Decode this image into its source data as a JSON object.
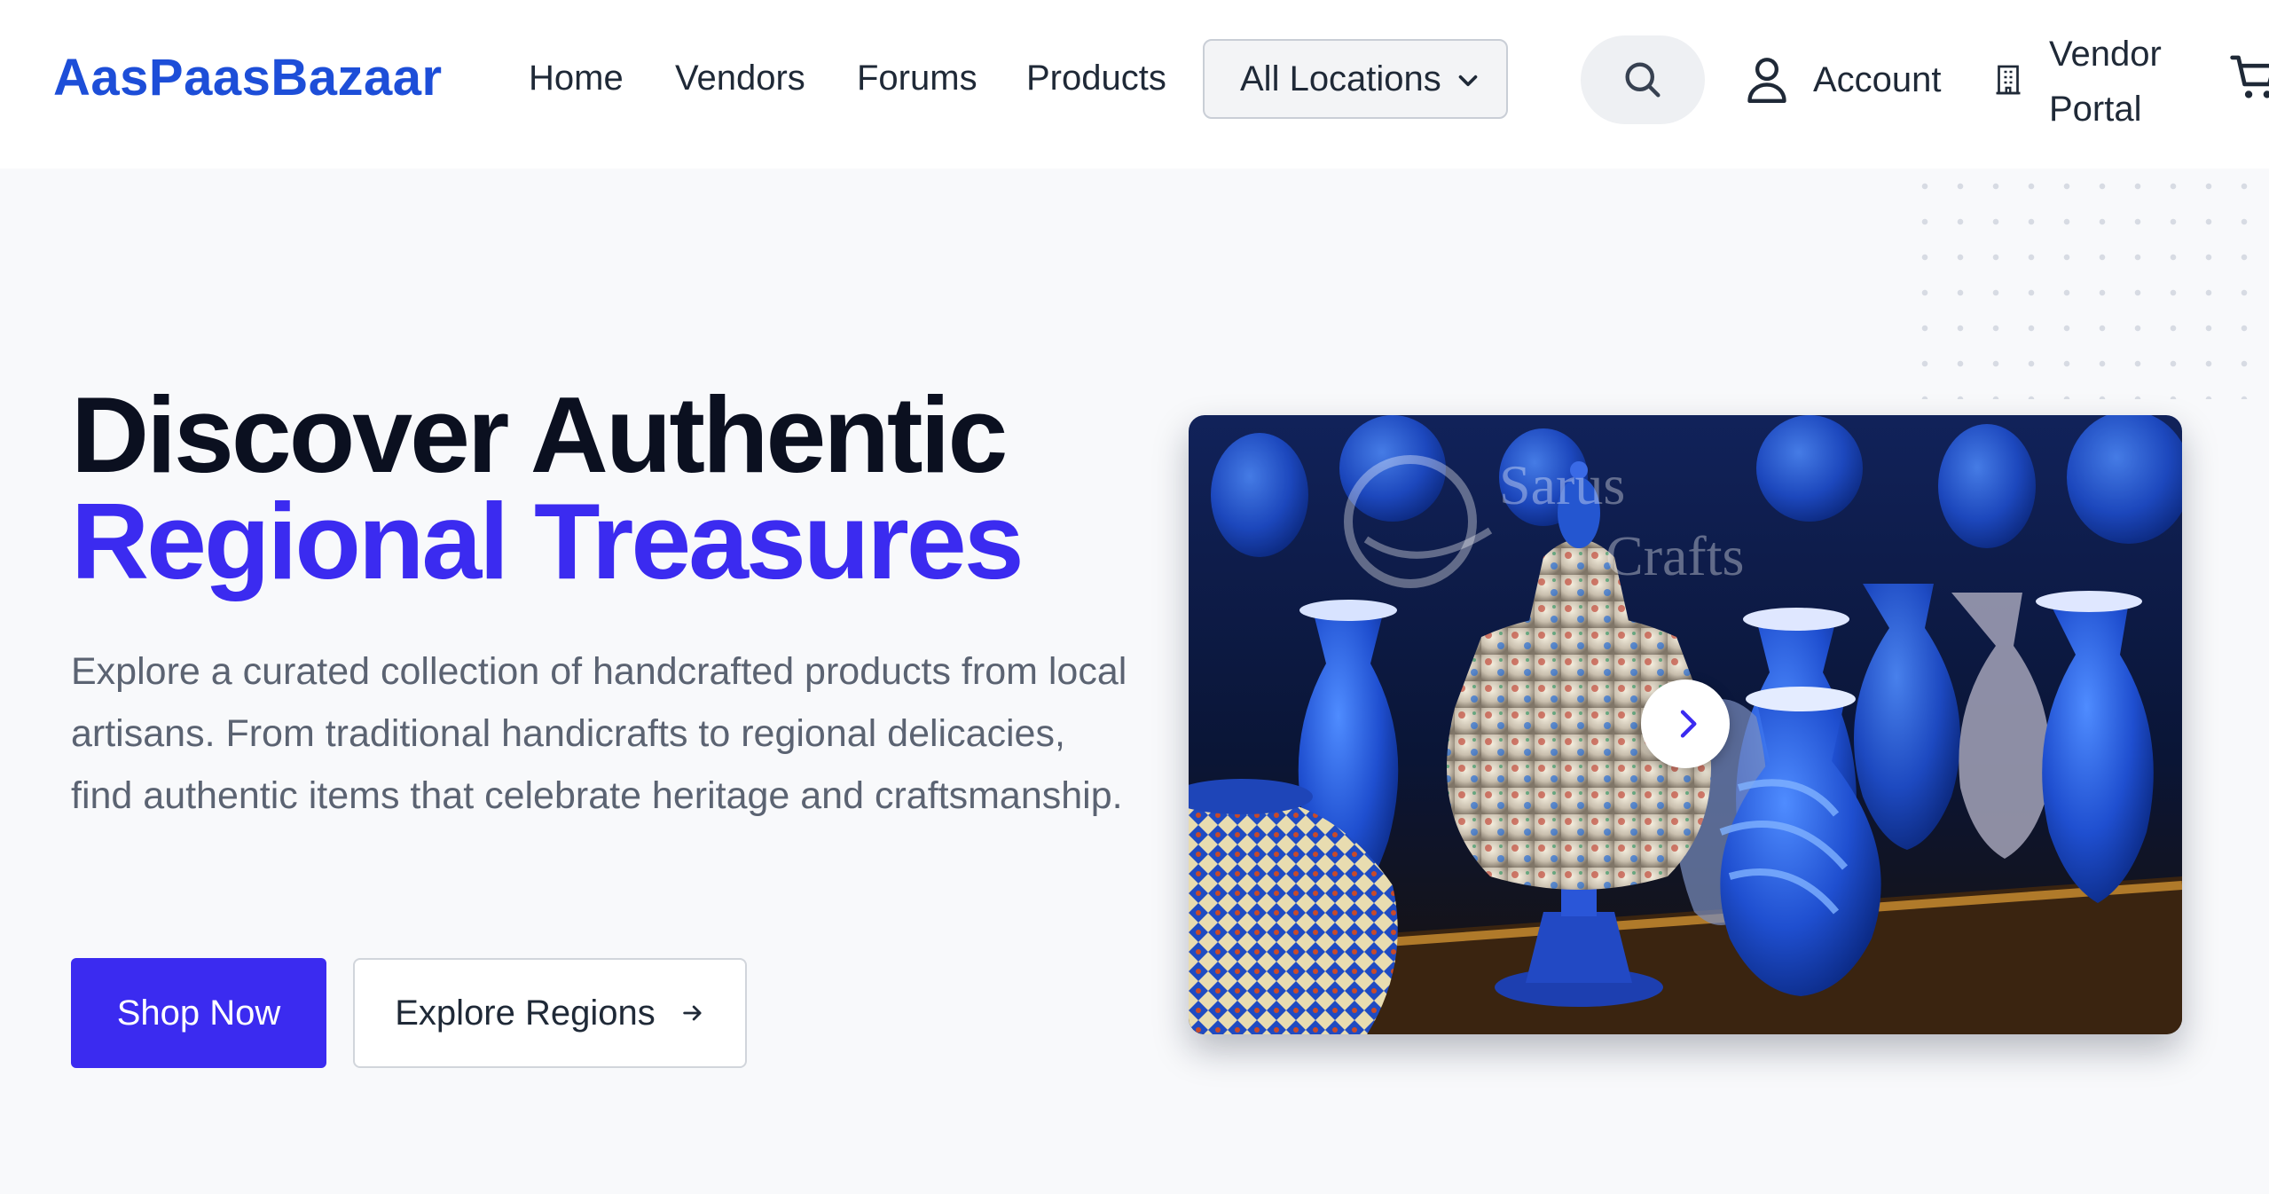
{
  "header": {
    "logo": "AasPaasBazaar",
    "nav": [
      {
        "label": "Home"
      },
      {
        "label": "Vendors"
      },
      {
        "label": "Forums"
      },
      {
        "label": "Products"
      }
    ],
    "location_select": {
      "value": "All Locations"
    },
    "search_icon": "search-icon",
    "account_label": "Account",
    "vendor_portal_label_line1": "Vendor",
    "vendor_portal_label_line2": "Portal",
    "cart_icon": "cart-icon"
  },
  "hero": {
    "title_line1": "Discover Authentic",
    "title_line2": "Regional Treasures",
    "description": "Explore a curated collection of handcrafted products from local artisans. From traditional handicrafts to regional delicacies, find authentic items that celebrate heritage and craftsmanship.",
    "primary_button": "Shop Now",
    "secondary_button": "Explore Regions",
    "image_watermark": "Sarus Crafts",
    "carousel_next_icon": "chevron-right-icon"
  },
  "colors": {
    "brand_blue": "#1d4ed8",
    "accent_purple": "#3b2bf0",
    "page_bg": "#f8f9fb"
  }
}
